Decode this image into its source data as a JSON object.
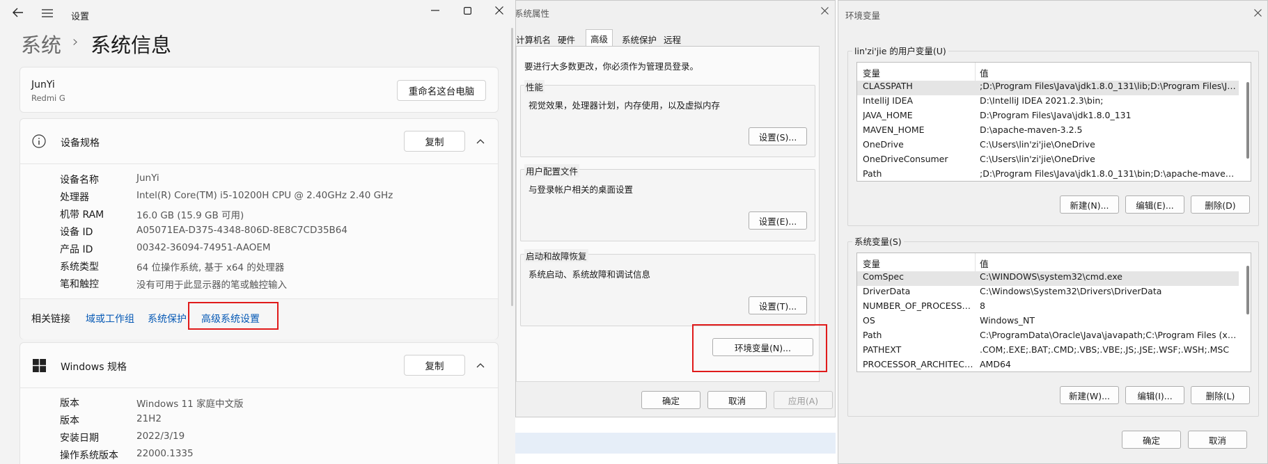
{
  "settings": {
    "app_title": "设置",
    "breadcrumb": {
      "parent": "系统",
      "separator": "›",
      "current": "系统信息"
    },
    "device": {
      "name": "JunYi",
      "model": "Redmi G",
      "rename_button": "重命名这台电脑"
    },
    "device_specs": {
      "header": "设备规格",
      "copy_button": "复制",
      "rows": [
        {
          "label": "设备名称",
          "value": "JunYi"
        },
        {
          "label": "处理器",
          "value": "Intel(R) Core(TM) i5-10200H CPU @ 2.40GHz   2.40 GHz"
        },
        {
          "label": "机带 RAM",
          "value": "16.0 GB (15.9 GB 可用)"
        },
        {
          "label": "设备 ID",
          "value": "A05071EA-D375-4348-806D-8E8C7CD35B64"
        },
        {
          "label": "产品 ID",
          "value": "00342-36094-74951-AAOEM"
        },
        {
          "label": "系统类型",
          "value": "64 位操作系统, 基于 x64 的处理器"
        },
        {
          "label": "笔和触控",
          "value": "没有可用于此显示器的笔或触控输入"
        }
      ]
    },
    "related_links": {
      "label": "相关链接",
      "links": [
        "域或工作组",
        "系统保护",
        "高级系统设置"
      ]
    },
    "windows_specs": {
      "header": "Windows 规格",
      "copy_button": "复制",
      "rows": [
        {
          "label": "版本",
          "value": "Windows 11 家庭中文版"
        },
        {
          "label": "版本",
          "value": "21H2"
        },
        {
          "label": "安装日期",
          "value": "2022/3/19"
        },
        {
          "label": "操作系统版本",
          "value": "22000.1335"
        }
      ]
    }
  },
  "system_properties": {
    "title": "系统属性",
    "tabs": [
      "计算机名",
      "硬件",
      "高级",
      "系统保护",
      "远程"
    ],
    "active_tab": "高级",
    "admin_notice": "要进行大多数更改，你必须作为管理员登录。",
    "groups": [
      {
        "title": "性能",
        "desc": "视觉效果，处理器计划，内存使用，以及虚拟内存",
        "button": "设置(S)..."
      },
      {
        "title": "用户配置文件",
        "desc": "与登录帐户相关的桌面设置",
        "button": "设置(E)..."
      },
      {
        "title": "启动和故障恢复",
        "desc": "系统启动、系统故障和调试信息",
        "button": "设置(T)..."
      }
    ],
    "env_button": "环境变量(N)...",
    "ok": "确定",
    "cancel": "取消",
    "apply": "应用(A)"
  },
  "environment_variables": {
    "title": "环境变量",
    "user_section": "lin'zi'jie 的用户变量(U)",
    "system_section": "系统变量(S)",
    "col_var": "变量",
    "col_val": "值",
    "user_vars": [
      {
        "name": "CLASSPATH",
        "value": ";D:\\Program Files\\Java\\jdk1.8.0_131\\lib;D:\\Program Files\\Java..."
      },
      {
        "name": "IntelliJ IDEA",
        "value": "D:\\IntelliJ IDEA 2021.2.3\\bin;"
      },
      {
        "name": "JAVA_HOME",
        "value": "D:\\Program Files\\Java\\jdk1.8.0_131"
      },
      {
        "name": "MAVEN_HOME",
        "value": "D:\\apache-maven-3.2.5"
      },
      {
        "name": "OneDrive",
        "value": "C:\\Users\\lin'zi'jie\\OneDrive"
      },
      {
        "name": "OneDriveConsumer",
        "value": "C:\\Users\\lin'zi'jie\\OneDrive"
      },
      {
        "name": "Path",
        "value": ";D:\\Program Files\\Java\\jdk1.8.0_131\\bin;D:\\apache-maven-3.2..."
      }
    ],
    "system_vars": [
      {
        "name": "ComSpec",
        "value": "C:\\WINDOWS\\system32\\cmd.exe"
      },
      {
        "name": "DriverData",
        "value": "C:\\Windows\\System32\\Drivers\\DriverData"
      },
      {
        "name": "NUMBER_OF_PROCESSORS",
        "value": "8"
      },
      {
        "name": "OS",
        "value": "Windows_NT"
      },
      {
        "name": "Path",
        "value": "C:\\ProgramData\\Oracle\\Java\\javapath;C:\\Program Files (x86)\\..."
      },
      {
        "name": "PATHEXT",
        "value": ".COM;.EXE;.BAT;.CMD;.VBS;.VBE;.JS;.JSE;.WSF;.WSH;.MSC"
      },
      {
        "name": "PROCESSOR_ARCHITECT...",
        "value": "AMD64"
      }
    ],
    "user_buttons": [
      "新建(N)...",
      "编辑(E)...",
      "删除(D)"
    ],
    "system_buttons": [
      "新建(W)...",
      "编辑(I)...",
      "删除(L)"
    ],
    "ok": "确定",
    "cancel": "取消"
  }
}
